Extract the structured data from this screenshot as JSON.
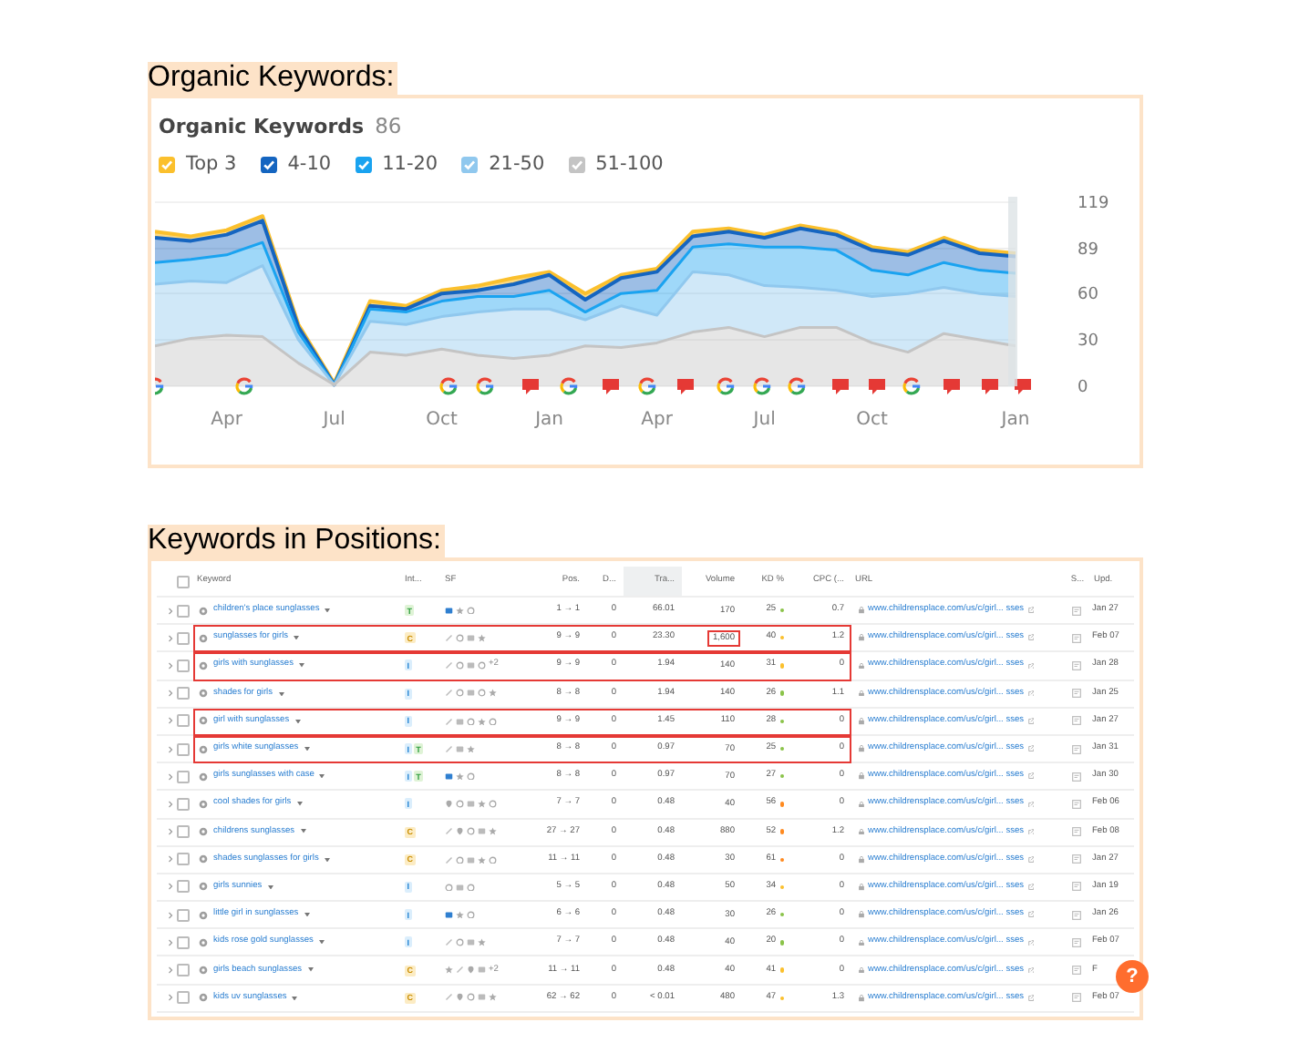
{
  "sections": [
    {
      "heading": "Organic Keywords:"
    },
    {
      "heading": "Keywords in Positions:"
    }
  ],
  "chart": {
    "title": "Organic Keywords",
    "count": "86",
    "legend": [
      {
        "checked": true
      },
      {
        "checked": true
      },
      {
        "checked": true
      },
      {
        "checked": true
      },
      {
        "checked": true
      }
    ],
    "chart_data": {
      "type": "area",
      "stacked": true,
      "grid": true,
      "categories": [
        null,
        null,
        "Apr",
        null,
        null,
        "Jul",
        null,
        null,
        "Oct",
        null,
        null,
        "Jan",
        null,
        null,
        "Apr",
        null,
        null,
        "Jul",
        null,
        null,
        "Oct",
        null,
        null,
        null,
        "Jan"
      ],
      "ylim": [
        0,
        119
      ],
      "yticks": [
        119,
        89,
        60,
        30,
        0
      ],
      "series": [
        {
          "name": "Top 3",
          "color": "#fbc02d",
          "values": [
            4,
            3,
            3,
            3,
            2,
            1,
            3,
            2,
            2,
            3,
            4,
            2,
            4,
            2,
            2,
            3,
            2,
            2,
            2,
            2,
            2,
            2,
            2,
            2,
            2
          ]
        },
        {
          "name": "4-10",
          "color": "#1565c0",
          "values": [
            16,
            12,
            13,
            14,
            3,
            0,
            2,
            2,
            5,
            4,
            8,
            10,
            8,
            10,
            12,
            7,
            8,
            6,
            12,
            10,
            13,
            13,
            14,
            11,
            11
          ]
        },
        {
          "name": "11-20",
          "color": "#1aa3f0",
          "values": [
            14,
            14,
            18,
            15,
            5,
            0,
            8,
            8,
            10,
            10,
            8,
            12,
            5,
            8,
            16,
            16,
            20,
            25,
            26,
            26,
            17,
            12,
            16,
            15,
            15
          ]
        },
        {
          "name": "21-50",
          "color": "#90c8ee",
          "values": [
            40,
            37,
            34,
            46,
            15,
            0,
            20,
            20,
            21,
            28,
            32,
            30,
            17,
            27,
            18,
            39,
            34,
            33,
            26,
            24,
            30,
            38,
            30,
            30,
            32
          ]
        },
        {
          "name": "51-100",
          "color": "#c4c4c4",
          "values": [
            26,
            31,
            33,
            32,
            15,
            1,
            22,
            20,
            24,
            20,
            18,
            20,
            26,
            25,
            28,
            35,
            38,
            32,
            38,
            38,
            28,
            22,
            34,
            30,
            26
          ]
        }
      ]
    },
    "markers": [
      {
        "kind": "ring"
      },
      {
        "kind": "ring"
      },
      {
        "kind": "ring"
      },
      {
        "kind": "ring"
      },
      {
        "kind": "note"
      },
      {
        "kind": "ring"
      },
      {
        "kind": "note"
      },
      {
        "kind": "ring"
      },
      {
        "kind": "note"
      },
      {
        "kind": "ring"
      },
      {
        "kind": "ring"
      },
      {
        "kind": "ring"
      },
      {
        "kind": "note"
      },
      {
        "kind": "note"
      },
      {
        "kind": "ring"
      },
      {
        "kind": "note"
      },
      {
        "kind": "note"
      },
      {
        "kind": "note"
      }
    ]
  },
  "table": {
    "all_checked": false,
    "columns": [
      {
        "label": "Keyword",
        "sorted": false
      },
      {
        "label": "Int...",
        "sorted": false
      },
      {
        "label": "SF",
        "sorted": false
      },
      {
        "label": "Pos.",
        "sorted": false
      },
      {
        "label": "D...",
        "sorted": false
      },
      {
        "label": "Tra...",
        "sorted": true
      },
      {
        "label": "Volume",
        "sorted": false
      },
      {
        "label": "KD %",
        "sorted": false
      },
      {
        "label": "CPC (...",
        "sorted": false
      },
      {
        "label": "URL",
        "sorted": false
      },
      {
        "label": "S...",
        "sorted": false
      },
      {
        "label": "Upd.",
        "sorted": false
      }
    ],
    "rows": [
      {
        "checked": false,
        "keyword": "children's place sunglasses",
        "intents": [
          {
            "kind": "transactional",
            "label": "T"
          }
        ],
        "sf": [
          {
            "kind": "image"
          },
          {
            "kind": "star"
          },
          {
            "kind": "target"
          }
        ],
        "sf_more": "",
        "pos": "1 → 1",
        "diff": "0",
        "traffic": "66.01",
        "volume": "170",
        "volume_marked": false,
        "kd": "25",
        "color": "#8bc34a",
        "cpc": "0.7",
        "url": "www.childrensplace.com/us/c/girl... sses",
        "updated": "Jan 27",
        "highlighted": false
      },
      {
        "checked": false,
        "keyword": "sunglasses for girls",
        "intents": [
          {
            "kind": "commercial",
            "label": "C"
          }
        ],
        "sf": [
          {
            "kind": "link"
          },
          {
            "kind": "target"
          },
          {
            "kind": "image"
          },
          {
            "kind": "star"
          }
        ],
        "sf_more": "",
        "pos": "9 → 9",
        "diff": "0",
        "traffic": "23.30",
        "volume": "1,600",
        "volume_marked": true,
        "kd": "40",
        "color": "#fbc02d",
        "cpc": "1.2",
        "url": "www.childrensplace.com/us/c/girl... sses",
        "updated": "Feb 07",
        "highlighted": true
      },
      {
        "checked": false,
        "keyword": "girls with sunglasses",
        "intents": [
          {
            "kind": "informational",
            "label": "I"
          }
        ],
        "sf": [
          {
            "kind": "link"
          },
          {
            "kind": "target"
          },
          {
            "kind": "image"
          },
          {
            "kind": "target"
          }
        ],
        "sf_more": "+2",
        "pos": "9 → 9",
        "diff": "0",
        "traffic": "1.94",
        "volume": "140",
        "volume_marked": false,
        "kd": "31",
        "color": "#fbc02d",
        "cpc": "0",
        "url": "www.childrensplace.com/us/c/girl... sses",
        "updated": "Jan 28",
        "highlighted": true
      },
      {
        "checked": false,
        "keyword": "shades for girls",
        "intents": [
          {
            "kind": "informational",
            "label": "I"
          }
        ],
        "sf": [
          {
            "kind": "link"
          },
          {
            "kind": "target"
          },
          {
            "kind": "image"
          },
          {
            "kind": "target"
          },
          {
            "kind": "star"
          }
        ],
        "sf_more": "",
        "pos": "8 → 8",
        "diff": "0",
        "traffic": "1.94",
        "volume": "140",
        "volume_marked": false,
        "kd": "26",
        "color": "#8bc34a",
        "cpc": "1.1",
        "url": "www.childrensplace.com/us/c/girl... sses",
        "updated": "Jan 25",
        "highlighted": false
      },
      {
        "checked": false,
        "keyword": "girl with sunglasses",
        "intents": [
          {
            "kind": "informational",
            "label": "I"
          }
        ],
        "sf": [
          {
            "kind": "link"
          },
          {
            "kind": "image"
          },
          {
            "kind": "target"
          },
          {
            "kind": "star"
          },
          {
            "kind": "target"
          }
        ],
        "sf_more": "",
        "pos": "9 → 9",
        "diff": "0",
        "traffic": "1.45",
        "volume": "110",
        "volume_marked": false,
        "kd": "28",
        "color": "#8bc34a",
        "cpc": "0",
        "url": "www.childrensplace.com/us/c/girl... sses",
        "updated": "Jan 27",
        "highlighted": true
      },
      {
        "checked": false,
        "keyword": "girls white sunglasses",
        "intents": [
          {
            "kind": "informational",
            "label": "I"
          },
          {
            "kind": "transactional",
            "label": "T"
          }
        ],
        "sf": [
          {
            "kind": "link"
          },
          {
            "kind": "image"
          },
          {
            "kind": "star"
          }
        ],
        "sf_more": "",
        "pos": "8 → 8",
        "diff": "0",
        "traffic": "0.97",
        "volume": "70",
        "volume_marked": false,
        "kd": "25",
        "color": "#8bc34a",
        "cpc": "0",
        "url": "www.childrensplace.com/us/c/girl... sses",
        "updated": "Jan 31",
        "highlighted": true
      },
      {
        "checked": false,
        "keyword": "girls sunglasses with case",
        "intents": [
          {
            "kind": "informational",
            "label": "I"
          },
          {
            "kind": "transactional",
            "label": "T"
          }
        ],
        "sf": [
          {
            "kind": "image"
          },
          {
            "kind": "star"
          },
          {
            "kind": "target"
          }
        ],
        "sf_more": "",
        "pos": "8 → 8",
        "diff": "0",
        "traffic": "0.97",
        "volume": "70",
        "volume_marked": false,
        "kd": "27",
        "color": "#8bc34a",
        "cpc": "0",
        "url": "www.childrensplace.com/us/c/girl... sses",
        "updated": "Jan 30",
        "highlighted": false
      },
      {
        "checked": false,
        "keyword": "cool shades for girls",
        "intents": [
          {
            "kind": "informational",
            "label": "I"
          }
        ],
        "sf": [
          {
            "kind": "pin"
          },
          {
            "kind": "target"
          },
          {
            "kind": "image"
          },
          {
            "kind": "star"
          },
          {
            "kind": "target"
          }
        ],
        "sf_more": "",
        "pos": "7 → 7",
        "diff": "0",
        "traffic": "0.48",
        "volume": "40",
        "volume_marked": false,
        "kd": "56",
        "color": "#ff8a1f",
        "cpc": "0",
        "url": "www.childrensplace.com/us/c/girl... sses",
        "updated": "Feb 06",
        "highlighted": false
      },
      {
        "checked": false,
        "keyword": "childrens sunglasses",
        "intents": [
          {
            "kind": "commercial",
            "label": "C"
          }
        ],
        "sf": [
          {
            "kind": "link"
          },
          {
            "kind": "pin"
          },
          {
            "kind": "target"
          },
          {
            "kind": "image"
          },
          {
            "kind": "star"
          }
        ],
        "sf_more": "",
        "pos": "27 → 27",
        "diff": "0",
        "traffic": "0.48",
        "volume": "880",
        "volume_marked": false,
        "kd": "52",
        "color": "#ff8a1f",
        "cpc": "1.2",
        "url": "www.childrensplace.com/us/c/girl... sses",
        "updated": "Feb 08",
        "highlighted": false
      },
      {
        "checked": false,
        "keyword": "shades sunglasses for girls",
        "intents": [
          {
            "kind": "commercial",
            "label": "C"
          }
        ],
        "sf": [
          {
            "kind": "link"
          },
          {
            "kind": "target"
          },
          {
            "kind": "image"
          },
          {
            "kind": "star"
          },
          {
            "kind": "target"
          }
        ],
        "sf_more": "",
        "pos": "11 → 11",
        "diff": "0",
        "traffic": "0.48",
        "volume": "30",
        "volume_marked": false,
        "kd": "61",
        "color": "#ff8a1f",
        "cpc": "0",
        "url": "www.childrensplace.com/us/c/girl... sses",
        "updated": "Jan 27",
        "highlighted": false
      },
      {
        "checked": false,
        "keyword": "girls sunnies",
        "intents": [
          {
            "kind": "informational",
            "label": "I"
          }
        ],
        "sf": [
          {
            "kind": "target"
          },
          {
            "kind": "image"
          },
          {
            "kind": "target"
          }
        ],
        "sf_more": "",
        "pos": "5 → 5",
        "diff": "0",
        "traffic": "0.48",
        "volume": "50",
        "volume_marked": false,
        "kd": "34",
        "color": "#fbc02d",
        "cpc": "0",
        "url": "www.childrensplace.com/us/c/girl... sses",
        "updated": "Jan 19",
        "highlighted": false
      },
      {
        "checked": false,
        "keyword": "little girl in sunglasses",
        "intents": [
          {
            "kind": "informational",
            "label": "I"
          }
        ],
        "sf": [
          {
            "kind": "image"
          },
          {
            "kind": "star"
          },
          {
            "kind": "target"
          }
        ],
        "sf_more": "",
        "pos": "6 → 6",
        "diff": "0",
        "traffic": "0.48",
        "volume": "30",
        "volume_marked": false,
        "kd": "26",
        "color": "#8bc34a",
        "cpc": "0",
        "url": "www.childrensplace.com/us/c/girl... sses",
        "updated": "Jan 26",
        "highlighted": false
      },
      {
        "checked": false,
        "keyword": "kids rose gold sunglasses",
        "intents": [
          {
            "kind": "informational",
            "label": "I"
          }
        ],
        "sf": [
          {
            "kind": "link"
          },
          {
            "kind": "target"
          },
          {
            "kind": "image"
          },
          {
            "kind": "star"
          }
        ],
        "sf_more": "",
        "pos": "7 → 7",
        "diff": "0",
        "traffic": "0.48",
        "volume": "40",
        "volume_marked": false,
        "kd": "20",
        "color": "#8bc34a",
        "cpc": "0",
        "url": "www.childrensplace.com/us/c/girl... sses",
        "updated": "Feb 07",
        "highlighted": false
      },
      {
        "checked": false,
        "keyword": "girls beach sunglasses",
        "intents": [
          {
            "kind": "commercial",
            "label": "C"
          }
        ],
        "sf": [
          {
            "kind": "star"
          },
          {
            "kind": "link"
          },
          {
            "kind": "pin"
          },
          {
            "kind": "image"
          }
        ],
        "sf_more": "+2",
        "pos": "11 → 11",
        "diff": "0",
        "traffic": "0.48",
        "volume": "40",
        "volume_marked": false,
        "kd": "41",
        "color": "#fbc02d",
        "cpc": "0",
        "url": "www.childrensplace.com/us/c/girl... sses",
        "updated": "F",
        "highlighted": false
      },
      {
        "checked": false,
        "keyword": "kids uv sunglasses",
        "intents": [
          {
            "kind": "commercial",
            "label": "C"
          }
        ],
        "sf": [
          {
            "kind": "link"
          },
          {
            "kind": "pin"
          },
          {
            "kind": "target"
          },
          {
            "kind": "image"
          },
          {
            "kind": "star"
          }
        ],
        "sf_more": "",
        "pos": "62 → 62",
        "diff": "0",
        "traffic": "< 0.01",
        "volume": "480",
        "volume_marked": false,
        "kd": "47",
        "color": "#fbc02d",
        "cpc": "1.3",
        "url": "www.childrensplace.com/us/c/girl... sses",
        "updated": "Feb 07",
        "highlighted": false
      }
    ]
  },
  "help_button": "?"
}
